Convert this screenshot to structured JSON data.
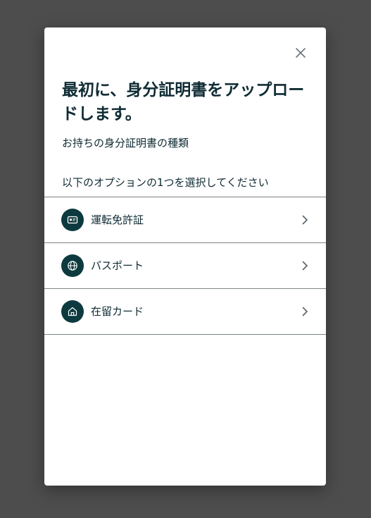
{
  "modal": {
    "title": "最初に、身分証明書をアップロードします。",
    "subtitle": "お持ちの身分証明書の種類",
    "instruction": "以下のオプションの1つを選択してください",
    "close_icon": "close-icon",
    "options": [
      {
        "label": "運転免許証",
        "icon": "id-card-icon"
      },
      {
        "label": "パスポート",
        "icon": "globe-icon"
      },
      {
        "label": "在留カード",
        "icon": "home-icon"
      }
    ]
  },
  "colors": {
    "backdrop": "#4d4d4d",
    "modal_bg": "#ffffff",
    "text": "#0f2b33",
    "icon_bg": "#0d3a3e",
    "divider": "#7d8488"
  }
}
